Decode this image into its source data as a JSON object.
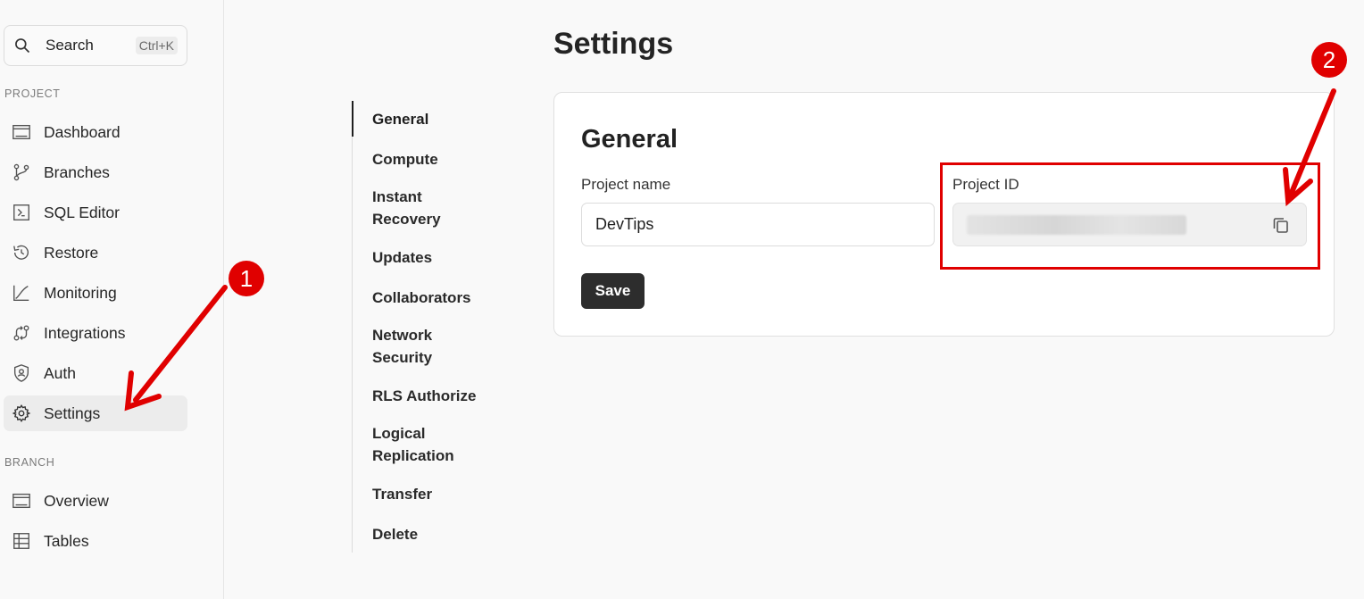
{
  "sidebar": {
    "search": {
      "label": "Search",
      "shortcut": "Ctrl+K"
    },
    "project_section": "PROJECT",
    "project_items": [
      {
        "label": "Dashboard",
        "icon": "dashboard-icon"
      },
      {
        "label": "Branches",
        "icon": "branches-icon"
      },
      {
        "label": "SQL Editor",
        "icon": "sql-editor-icon"
      },
      {
        "label": "Restore",
        "icon": "restore-icon"
      },
      {
        "label": "Monitoring",
        "icon": "monitoring-icon"
      },
      {
        "label": "Integrations",
        "icon": "integrations-icon"
      },
      {
        "label": "Auth",
        "icon": "auth-icon"
      },
      {
        "label": "Settings",
        "icon": "gear-icon",
        "active": true
      }
    ],
    "branch_section": "BRANCH",
    "branch_items": [
      {
        "label": "Overview",
        "icon": "overview-icon"
      },
      {
        "label": "Tables",
        "icon": "tables-icon"
      }
    ]
  },
  "subnav": {
    "items": [
      {
        "label": "General",
        "active": true
      },
      {
        "label": "Compute"
      },
      {
        "label": "Instant Recovery"
      },
      {
        "label": "Updates"
      },
      {
        "label": "Collaborators"
      },
      {
        "label": "Network Security"
      },
      {
        "label": "RLS Authorize"
      },
      {
        "label": "Logical Replication"
      },
      {
        "label": "Transfer"
      },
      {
        "label": "Delete"
      }
    ]
  },
  "main": {
    "title": "Settings",
    "card": {
      "title": "General",
      "project_name_label": "Project name",
      "project_name_value": "DevTips",
      "project_id_label": "Project ID",
      "save_label": "Save"
    }
  },
  "annotations": {
    "badge1": "1",
    "badge2": "2",
    "color": "#e00000"
  }
}
